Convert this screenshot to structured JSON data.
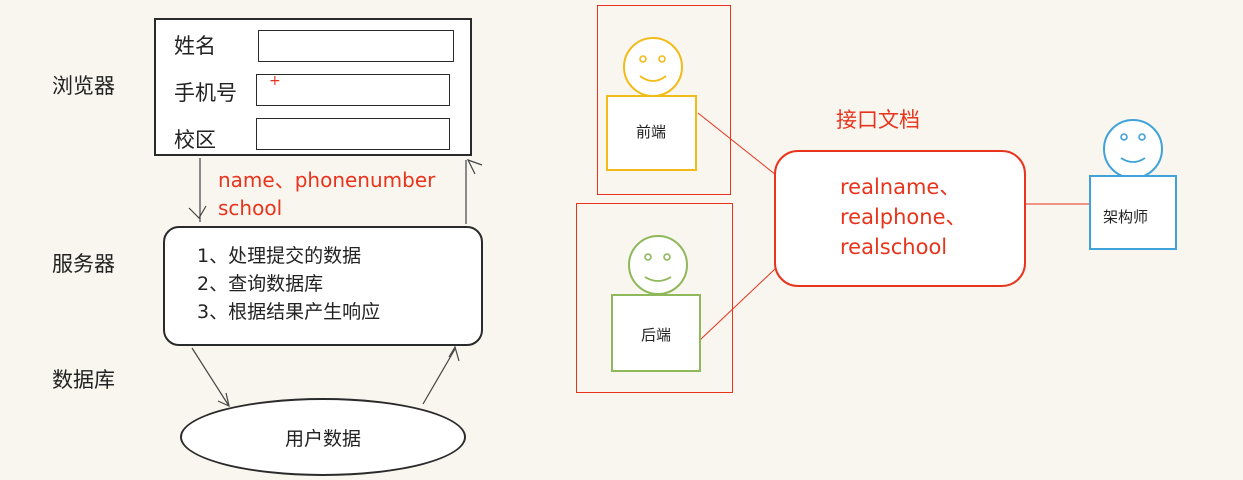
{
  "left": {
    "layers": {
      "browser": "浏览器",
      "server": "服务器",
      "database": "数据库"
    },
    "form": {
      "fields": [
        {
          "label": "姓名"
        },
        {
          "label": "手机号",
          "marker": "+"
        },
        {
          "label": "校区"
        }
      ]
    },
    "request_params": [
      "name、phonenumber",
      "school"
    ],
    "server_steps": [
      "1、处理提交的数据",
      "2、查询数据库",
      "3、根据结果产生响应"
    ],
    "db_label": "用户数据"
  },
  "right": {
    "frontend_label": "前端",
    "backend_label": "后端",
    "architect_label": "架构师",
    "api_doc_title": "接口文档",
    "api_fields": [
      "realname、",
      "realphone、",
      "realschool"
    ]
  },
  "colors": {
    "accent_red": "#e8341c",
    "frontend_yellow": "#f2bb17",
    "backend_green": "#8fb85a",
    "architect_blue": "#3fa3d9",
    "outline_dark": "#2a2a2a",
    "background": "#f9f5ef"
  },
  "icons": {
    "frontend": "smiley-person-icon",
    "backend": "smiley-person-icon",
    "architect": "smiley-person-icon"
  }
}
